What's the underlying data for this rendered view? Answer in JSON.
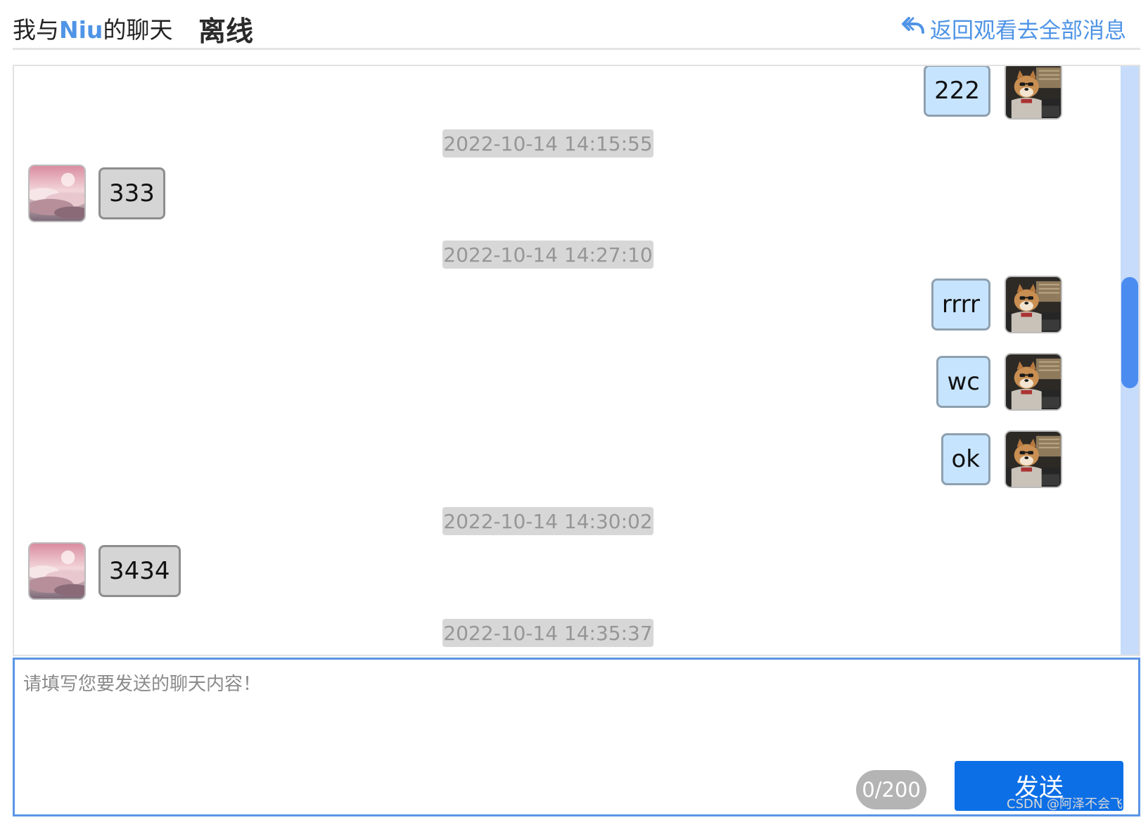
{
  "header": {
    "title_prefix": "我与",
    "title_name": "Niu",
    "title_suffix": "的聊天",
    "status": "离线",
    "back_label": "返回观看去全部消息"
  },
  "messages": [
    {
      "type": "msg",
      "side": "right",
      "text": "222",
      "avatar": "dog-avatar-icon"
    },
    {
      "type": "time",
      "text": "2022-10-14 14:15:55"
    },
    {
      "type": "msg",
      "side": "left",
      "text": "333",
      "avatar": "clouds-avatar-icon"
    },
    {
      "type": "time",
      "text": "2022-10-14 14:27:10"
    },
    {
      "type": "msg",
      "side": "right",
      "text": "rrrr",
      "avatar": "dog-avatar-icon"
    },
    {
      "type": "msg",
      "side": "right",
      "text": "wc",
      "avatar": "dog-avatar-icon"
    },
    {
      "type": "msg",
      "side": "right",
      "text": "ok",
      "avatar": "dog-avatar-icon"
    },
    {
      "type": "time",
      "text": "2022-10-14 14:30:02"
    },
    {
      "type": "msg",
      "side": "left",
      "text": "3434",
      "avatar": "clouds-avatar-icon"
    },
    {
      "type": "time",
      "text": "2022-10-14 14:35:37"
    }
  ],
  "input": {
    "placeholder": "请填写您要发送的聊天内容！",
    "value": "",
    "counter": "0/200",
    "send_label": "发送"
  },
  "watermark": "CSDN @阿泽不会飞",
  "colors": {
    "accent": "#4f94e6",
    "send_button": "#0d6fe6",
    "mine_bubble": "#c7e4ff",
    "theirs_bubble": "#d5d5d5",
    "timestamp_bg": "#d7d7d7"
  }
}
